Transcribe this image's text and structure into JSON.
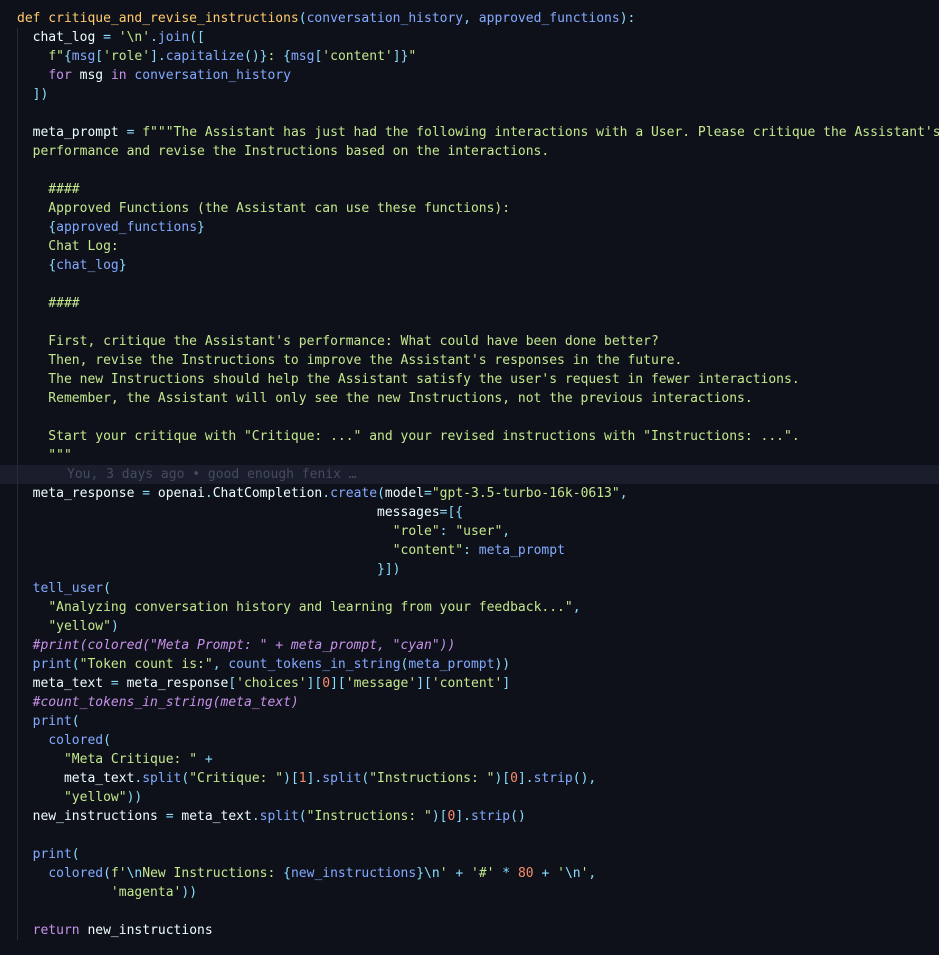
{
  "editor": {
    "blame_annotation": "You, 3 days ago • good enough fenix …",
    "lines": [
      [
        [
          "fnname",
          "def critique_and_revise_instructions"
        ],
        [
          "p",
          "("
        ],
        [
          "fn",
          "conversation_history"
        ],
        [
          "p",
          ", "
        ],
        [
          "fn",
          "approved_functions"
        ],
        [
          "p",
          "):"
        ]
      ],
      [
        [
          "v",
          "  chat_log "
        ],
        [
          "p",
          "= "
        ],
        [
          "s",
          "'\\n'"
        ],
        [
          "p",
          "."
        ],
        [
          "fn",
          "join"
        ],
        [
          "p",
          "(["
        ]
      ],
      [
        [
          "v",
          "    "
        ],
        [
          "s",
          "f\""
        ],
        [
          "p",
          "{"
        ],
        [
          "fn",
          "msg"
        ],
        [
          "p",
          "["
        ],
        [
          "s",
          "'role'"
        ],
        [
          "p",
          "]."
        ],
        [
          "fn",
          "capitalize"
        ],
        [
          "p",
          "()}"
        ],
        [
          "s",
          ": "
        ],
        [
          "p",
          "{"
        ],
        [
          "fn",
          "msg"
        ],
        [
          "p",
          "["
        ],
        [
          "s",
          "'content'"
        ],
        [
          "p",
          "]}"
        ],
        [
          "s",
          "\""
        ]
      ],
      [
        [
          "v",
          "    "
        ],
        [
          "k",
          "for"
        ],
        [
          "v",
          " msg "
        ],
        [
          "k",
          "in"
        ],
        [
          "fn",
          " conversation_history"
        ]
      ],
      [
        [
          "v",
          "  "
        ],
        [
          "p",
          "])"
        ]
      ],
      [],
      [
        [
          "v",
          "  meta_prompt "
        ],
        [
          "p",
          "= "
        ],
        [
          "s",
          "f\"\"\"The Assistant has just had the following interactions with a User. Please critique the Assistant's"
        ]
      ],
      [
        [
          "s",
          "  performance and revise the Instructions based on the interactions."
        ]
      ],
      [],
      [
        [
          "s",
          "    ####"
        ]
      ],
      [
        [
          "s",
          "    Approved Functions (the Assistant can use these functions):"
        ]
      ],
      [
        [
          "v",
          "    "
        ],
        [
          "p",
          "{"
        ],
        [
          "fn",
          "approved_functions"
        ],
        [
          "p",
          "}"
        ]
      ],
      [
        [
          "s",
          "    Chat Log:"
        ]
      ],
      [
        [
          "v",
          "    "
        ],
        [
          "p",
          "{"
        ],
        [
          "fn",
          "chat_log"
        ],
        [
          "p",
          "}"
        ]
      ],
      [],
      [
        [
          "s",
          "    ####"
        ]
      ],
      [],
      [
        [
          "s",
          "    First, critique the Assistant's performance: What could have been done better?"
        ]
      ],
      [
        [
          "s",
          "    Then, revise the Instructions to improve the Assistant's responses in the future."
        ]
      ],
      [
        [
          "s",
          "    The new Instructions should help the Assistant satisfy the user's request in fewer interactions."
        ]
      ],
      [
        [
          "s",
          "    Remember, the Assistant will only see the new Instructions, not the previous interactions."
        ]
      ],
      [],
      [
        [
          "s",
          "    Start your critique with \"Critique: ...\" and your revised instructions with \"Instructions: ...\"."
        ]
      ],
      [
        [
          "s",
          "    \"\"\""
        ]
      ],
      [],
      [
        [
          "v",
          "  meta_response "
        ],
        [
          "p",
          "= "
        ],
        [
          "v",
          "openai"
        ],
        [
          "p",
          "."
        ],
        [
          "v",
          "ChatCompletion"
        ],
        [
          "p",
          "."
        ],
        [
          "fn",
          "create"
        ],
        [
          "p",
          "("
        ],
        [
          "v",
          "model"
        ],
        [
          "p",
          "="
        ],
        [
          "s",
          "\"gpt-3.5-turbo-16k-0613\""
        ],
        [
          "p",
          ","
        ]
      ],
      [
        [
          "v",
          "                                              "
        ],
        [
          "v",
          "messages"
        ],
        [
          "p",
          "=[{"
        ]
      ],
      [
        [
          "v",
          "                                                "
        ],
        [
          "s",
          "\"role\""
        ],
        [
          "p",
          ": "
        ],
        [
          "s",
          "\"user\""
        ],
        [
          "p",
          ","
        ]
      ],
      [
        [
          "v",
          "                                                "
        ],
        [
          "s",
          "\"content\""
        ],
        [
          "p",
          ": "
        ],
        [
          "fn",
          "meta_prompt"
        ]
      ],
      [
        [
          "v",
          "                                              "
        ],
        [
          "p",
          "}])"
        ]
      ],
      [
        [
          "v",
          "  "
        ],
        [
          "fn",
          "tell_user"
        ],
        [
          "p",
          "("
        ]
      ],
      [
        [
          "v",
          "    "
        ],
        [
          "s",
          "\"Analyzing conversation history and learning from your feedback...\""
        ],
        [
          "p",
          ","
        ]
      ],
      [
        [
          "v",
          "    "
        ],
        [
          "s",
          "\"yellow\""
        ],
        [
          "p",
          ")"
        ]
      ],
      [
        [
          "c",
          "  #print(colored(\"Meta Prompt: \" + meta_prompt, \"cyan\"))"
        ]
      ],
      [
        [
          "v",
          "  "
        ],
        [
          "fn",
          "print"
        ],
        [
          "p",
          "("
        ],
        [
          "s",
          "\"Token count is:\""
        ],
        [
          "p",
          ", "
        ],
        [
          "fn",
          "count_tokens_in_string"
        ],
        [
          "p",
          "("
        ],
        [
          "fn",
          "meta_prompt"
        ],
        [
          "p",
          "))"
        ]
      ],
      [
        [
          "v",
          "  meta_text "
        ],
        [
          "p",
          "= "
        ],
        [
          "v",
          "meta_response"
        ],
        [
          "p",
          "["
        ],
        [
          "s",
          "'choices'"
        ],
        [
          "p",
          "]["
        ],
        [
          "num",
          "0"
        ],
        [
          "p",
          "]["
        ],
        [
          "s",
          "'message'"
        ],
        [
          "p",
          "]["
        ],
        [
          "s",
          "'content'"
        ],
        [
          "p",
          "]"
        ]
      ],
      [
        [
          "c",
          "  #count_tokens_in_string(meta_text)"
        ]
      ],
      [
        [
          "v",
          "  "
        ],
        [
          "fn",
          "print"
        ],
        [
          "p",
          "("
        ]
      ],
      [
        [
          "v",
          "    "
        ],
        [
          "fn",
          "colored"
        ],
        [
          "p",
          "("
        ]
      ],
      [
        [
          "v",
          "      "
        ],
        [
          "s",
          "\"Meta Critique: \""
        ],
        [
          "p",
          " +"
        ]
      ],
      [
        [
          "v",
          "      meta_text"
        ],
        [
          "p",
          "."
        ],
        [
          "fn",
          "split"
        ],
        [
          "p",
          "("
        ],
        [
          "s",
          "\"Critique: \""
        ],
        [
          "p",
          ")["
        ],
        [
          "num",
          "1"
        ],
        [
          "p",
          "]."
        ],
        [
          "fn",
          "split"
        ],
        [
          "p",
          "("
        ],
        [
          "s",
          "\"Instructions: \""
        ],
        [
          "p",
          ")["
        ],
        [
          "num",
          "0"
        ],
        [
          "p",
          "]."
        ],
        [
          "fn",
          "strip"
        ],
        [
          "p",
          "(),"
        ]
      ],
      [
        [
          "v",
          "      "
        ],
        [
          "s",
          "\"yellow\""
        ],
        [
          "p",
          "))"
        ]
      ],
      [
        [
          "v",
          "  new_instructions "
        ],
        [
          "p",
          "= "
        ],
        [
          "v",
          "meta_text"
        ],
        [
          "p",
          "."
        ],
        [
          "fn",
          "split"
        ],
        [
          "p",
          "("
        ],
        [
          "s",
          "\"Instructions: \""
        ],
        [
          "p",
          ")["
        ],
        [
          "num",
          "0"
        ],
        [
          "p",
          "]."
        ],
        [
          "fn",
          "strip"
        ],
        [
          "p",
          "()"
        ]
      ],
      [],
      [
        [
          "v",
          "  "
        ],
        [
          "fn",
          "print"
        ],
        [
          "p",
          "("
        ]
      ],
      [
        [
          "v",
          "    "
        ],
        [
          "fn",
          "colored"
        ],
        [
          "p",
          "("
        ],
        [
          "s",
          "f'"
        ],
        [
          "p",
          "\\n"
        ],
        [
          "s",
          "New Instructions: "
        ],
        [
          "p",
          "{"
        ],
        [
          "fn",
          "new_instructions"
        ],
        [
          "p",
          "}"
        ],
        [
          "p",
          "\\n"
        ],
        [
          "s",
          "'"
        ],
        [
          "p",
          " + "
        ],
        [
          "s",
          "'#'"
        ],
        [
          "p",
          " * "
        ],
        [
          "num",
          "80"
        ],
        [
          "p",
          " + "
        ],
        [
          "s",
          "'"
        ],
        [
          "p",
          "\\n"
        ],
        [
          "s",
          "'"
        ],
        [
          "p",
          ","
        ]
      ],
      [
        [
          "v",
          "            "
        ],
        [
          "s",
          "'magenta'"
        ],
        [
          "p",
          "))"
        ]
      ],
      [],
      [
        [
          "v",
          "  "
        ],
        [
          "k",
          "return"
        ],
        [
          "v",
          " new_instructions"
        ]
      ]
    ],
    "current_line_index": 24
  }
}
